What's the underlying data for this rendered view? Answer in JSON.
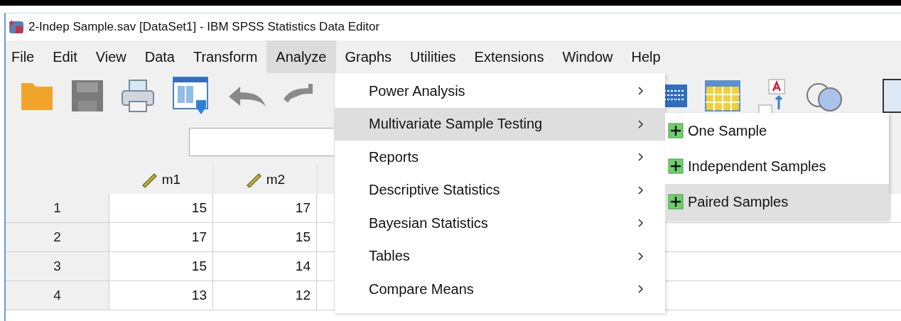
{
  "window": {
    "title": "2-Indep Sample.sav [DataSet1] - IBM SPSS Statistics Data Editor"
  },
  "menubar": [
    {
      "label": "File",
      "selected": false
    },
    {
      "label": "Edit",
      "selected": false
    },
    {
      "label": "View",
      "selected": false
    },
    {
      "label": "Data",
      "selected": false
    },
    {
      "label": "Transform",
      "selected": false
    },
    {
      "label": "Analyze",
      "selected": true
    },
    {
      "label": "Graphs",
      "selected": false
    },
    {
      "label": "Utilities",
      "selected": false
    },
    {
      "label": "Extensions",
      "selected": false
    },
    {
      "label": "Window",
      "selected": false
    },
    {
      "label": "Help",
      "selected": false
    }
  ],
  "grid": {
    "columns": [
      "m1",
      "m2"
    ],
    "rows": [
      {
        "number": "1",
        "cells": [
          "15",
          "17"
        ]
      },
      {
        "number": "2",
        "cells": [
          "17",
          "15"
        ]
      },
      {
        "number": "3",
        "cells": [
          "15",
          "14"
        ]
      },
      {
        "number": "4",
        "cells": [
          "13",
          "12"
        ]
      }
    ]
  },
  "analyze_menu": [
    {
      "label": "Power Analysis",
      "selected": false
    },
    {
      "label": "Multivariate Sample Testing",
      "selected": true
    },
    {
      "label": "Reports",
      "selected": false
    },
    {
      "label": "Descriptive Statistics",
      "selected": false
    },
    {
      "label": "Bayesian Statistics",
      "selected": false
    },
    {
      "label": "Tables",
      "selected": false
    },
    {
      "label": "Compare Means",
      "selected": false
    }
  ],
  "submenu": [
    {
      "label": "One Sample",
      "selected": false
    },
    {
      "label": "Independent Samples",
      "selected": false
    },
    {
      "label": "Paired Samples",
      "selected": true
    }
  ]
}
